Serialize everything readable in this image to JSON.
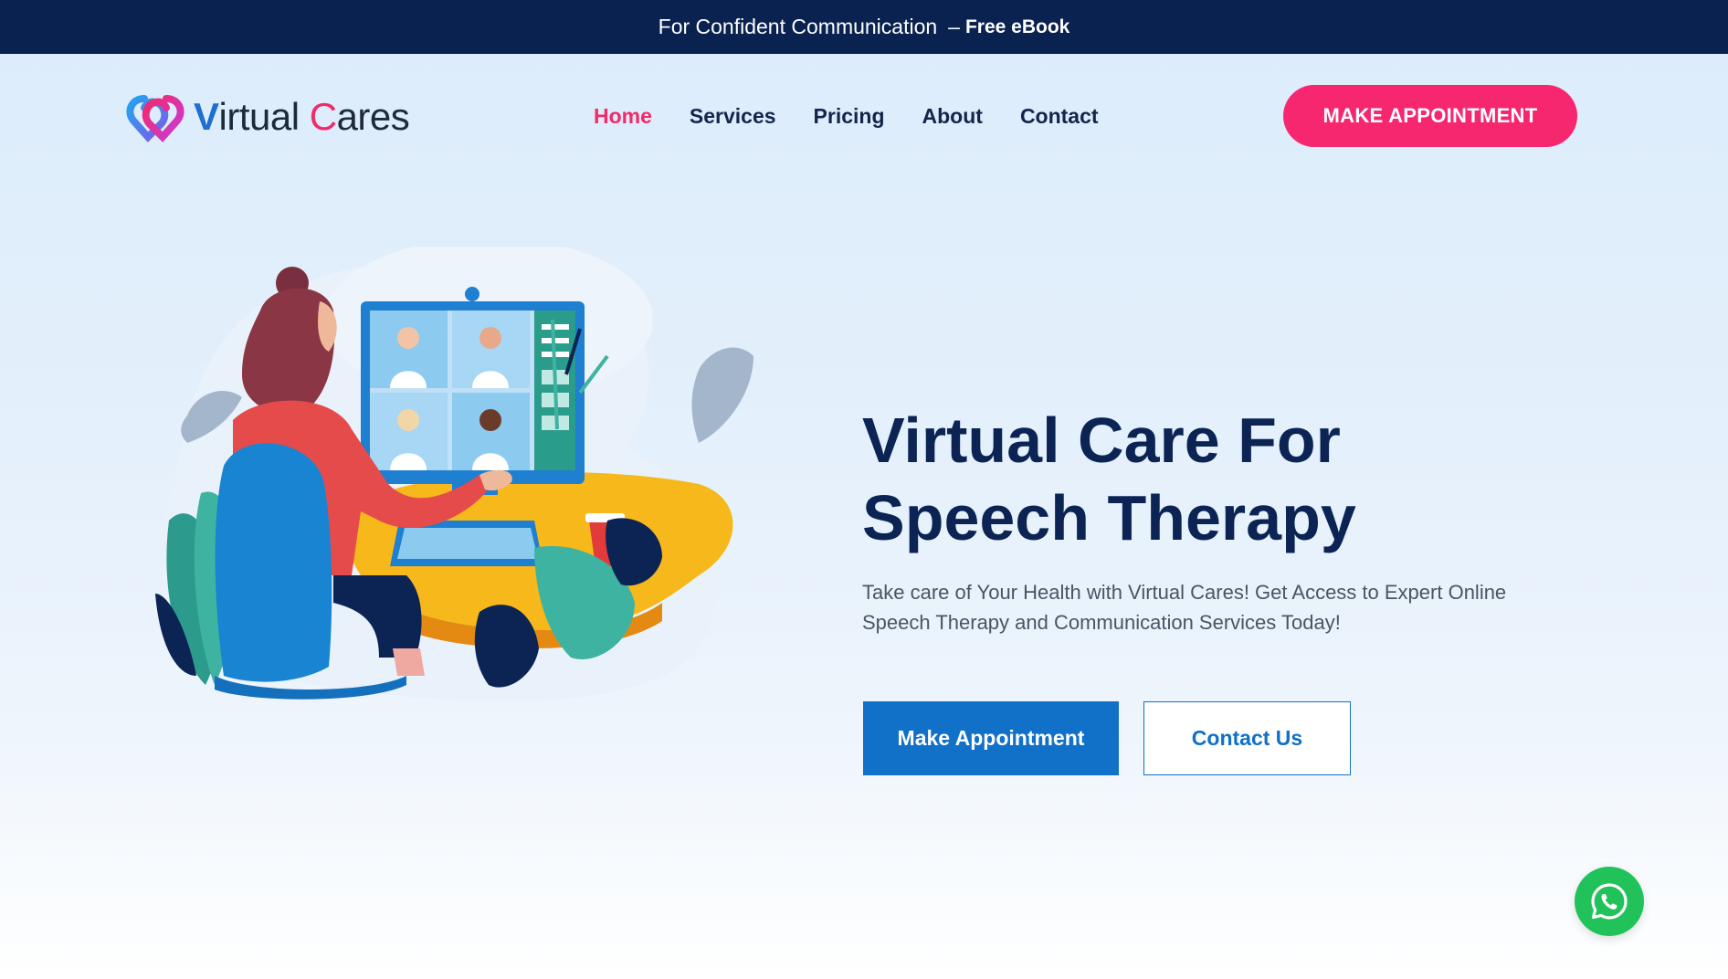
{
  "topbar": {
    "text": "For Confident Communication",
    "dash": "–",
    "link_label": "Free eBook"
  },
  "logo": {
    "first_letter": "V",
    "first_rest": "irtual",
    "second_letter": "C",
    "second_rest": "ares",
    "icon": "heart-logo-icon"
  },
  "nav": {
    "items": [
      {
        "label": "Home",
        "active": true
      },
      {
        "label": "Services",
        "active": false
      },
      {
        "label": "Pricing",
        "active": false
      },
      {
        "label": "About",
        "active": false
      },
      {
        "label": "Contact",
        "active": false
      }
    ],
    "cta_label": "MAKE APPOINTMENT"
  },
  "hero": {
    "title_line1": "Virtual Care For",
    "title_line2": "Speech Therapy",
    "subtitle_line1": "Take care of Your Health with Virtual Cares! Get Access to Expert Online",
    "subtitle_line2": "Speech Therapy and Communication Services Today!",
    "primary_button": "Make Appointment",
    "secondary_button": "Contact Us",
    "illustration": "video-call-illustration"
  },
  "floating": {
    "icon": "whatsapp-icon"
  },
  "colors": {
    "navy": "#0a2250",
    "pink": "#f7276f",
    "blue": "#1170c8",
    "whatsapp_green": "#22c25a"
  }
}
